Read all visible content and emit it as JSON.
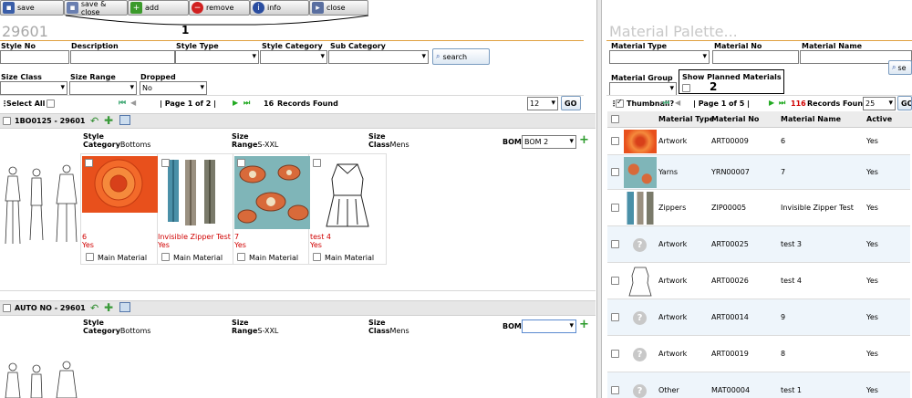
{
  "toolbar": {
    "save": "save",
    "save_close": "save & close",
    "add": "add",
    "remove": "remove",
    "info": "info",
    "close": "close",
    "callout_1": "1"
  },
  "left": {
    "title": "29601",
    "filters": {
      "style_no": "Style No",
      "description": "Description",
      "style_type": "Style Type",
      "style_category": "Style Category",
      "sub_category": "Sub Category",
      "search": "search",
      "size_class": "Size Class",
      "size_range": "Size Range",
      "dropped": "Dropped",
      "dropped_value": "No"
    },
    "pager": {
      "select_all": "Select All",
      "page": "| Page 1 of 2 |",
      "records_count": "16",
      "records_label": "Records Found",
      "page_size": "12",
      "go": "GO"
    },
    "styles": [
      {
        "header": "1BO0125 - 29601",
        "style_label": "Style",
        "category_label": "Category",
        "category_value": "Bottoms",
        "size_label": "Size",
        "range_label": "Range",
        "range_value": "S-XXL",
        "class_label": "Class",
        "class_value": "Mens",
        "bom_label": "BOM",
        "bom_value": "BOM 2",
        "materials": [
          {
            "name": "6",
            "active": "Yes",
            "main": "Main Material"
          },
          {
            "name": "Invisible Zipper Test",
            "active": "Yes",
            "main": "Main Material"
          },
          {
            "name": "7",
            "active": "Yes",
            "main": "Main Material"
          },
          {
            "name": "test 4",
            "active": "Yes",
            "main": "Main Material"
          }
        ]
      },
      {
        "header": "AUTO NO - 29601",
        "style_label": "Style",
        "category_label": "Category",
        "category_value": "Bottoms",
        "size_label": "Size",
        "range_label": "Range",
        "range_value": "S-XXL",
        "class_label": "Class",
        "class_value": "Mens",
        "bom_label": "BOM",
        "bom_value": ""
      }
    ]
  },
  "right": {
    "title": "Material Palette...",
    "filters": {
      "material_type": "Material Type",
      "material_no": "Material No",
      "material_name": "Material Name",
      "material_group": "Material Group",
      "show_planned": "Show Planned Materials",
      "callout_2": "2",
      "search_partial": "se"
    },
    "pager": {
      "thumbnail": "Thumbnail?",
      "page": "| Page 1 of 5 |",
      "records_count": "116",
      "records_label": "Records Found",
      "page_size": "25",
      "go_partial": "GO"
    },
    "table": {
      "headers": [
        "Material Type",
        "Material No",
        "Material Name",
        "Active"
      ],
      "rows": [
        {
          "type": "Artwork",
          "no": "ART00009",
          "name": "6",
          "active": "Yes",
          "thumb": "flower"
        },
        {
          "type": "Yarns",
          "no": "YRN00007",
          "name": "7",
          "active": "Yes",
          "thumb": "paisley"
        },
        {
          "type": "Zippers",
          "no": "ZIP00005",
          "name": "Invisible Zipper Test",
          "active": "Yes",
          "thumb": "zipper"
        },
        {
          "type": "Artwork",
          "no": "ART00025",
          "name": "test 3",
          "active": "Yes",
          "thumb": "question"
        },
        {
          "type": "Artwork",
          "no": "ART00026",
          "name": "test 4",
          "active": "Yes",
          "thumb": "garment"
        },
        {
          "type": "Artwork",
          "no": "ART00014",
          "name": "9",
          "active": "Yes",
          "thumb": "question"
        },
        {
          "type": "Artwork",
          "no": "ART00019",
          "name": "8",
          "active": "Yes",
          "thumb": "question"
        },
        {
          "type": "Other",
          "no": "MAT00004",
          "name": "test 1",
          "active": "Yes",
          "thumb": "question"
        }
      ]
    }
  }
}
